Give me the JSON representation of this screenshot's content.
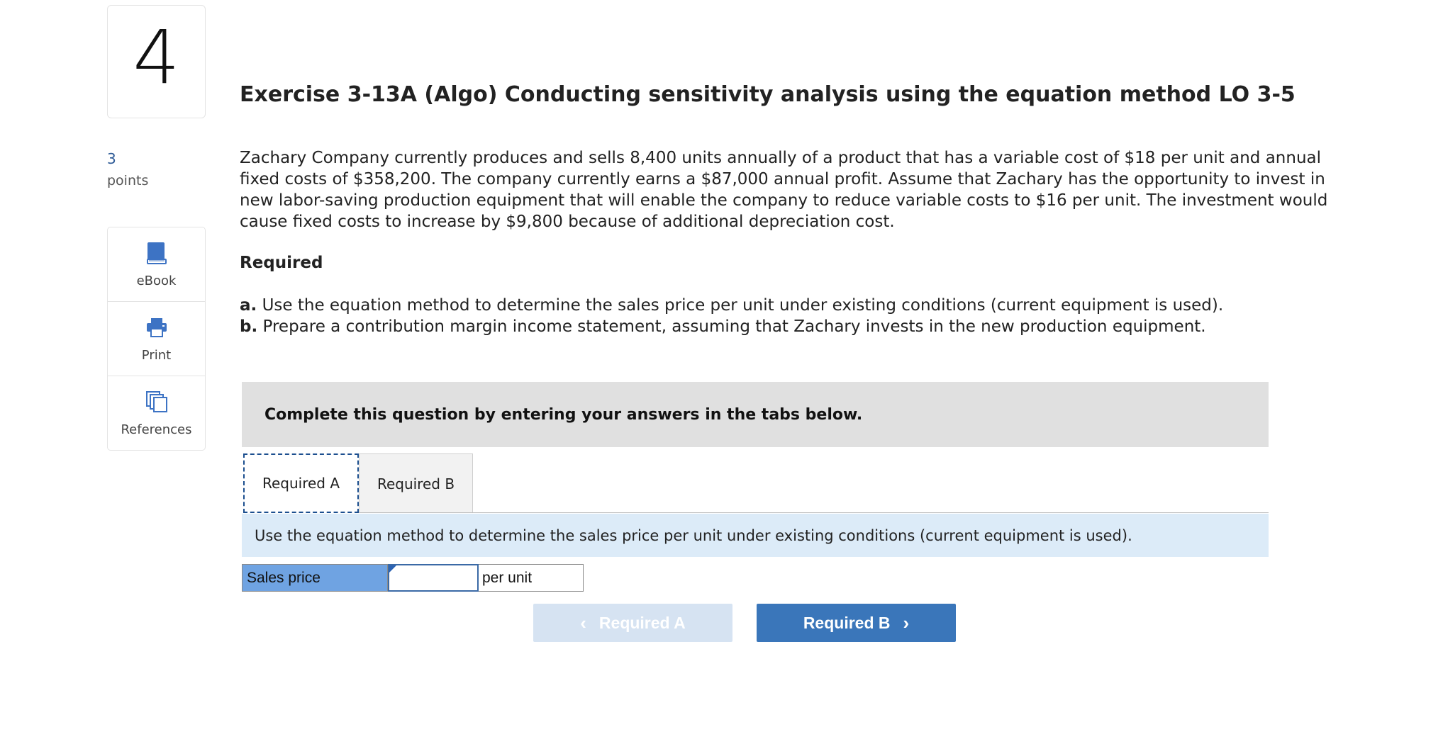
{
  "question": {
    "number": "4",
    "points_value": "3",
    "points_label": "points",
    "title": "Exercise 3-13A (Algo) Conducting sensitivity analysis using the equation method LO 3-5",
    "prompt": "Zachary Company currently produces and sells 8,400 units annually of a product that has a variable cost of $18 per unit and annual fixed costs of $358,200. The company currently earns a $87,000 annual profit. Assume that Zachary has the opportunity to invest in new labor-saving production equipment that will enable the company to reduce variable costs to $16 per unit. The investment would cause fixed costs to increase by $9,800 because of additional depreciation cost.",
    "required_heading": "Required",
    "requirements": [
      {
        "letter": "a.",
        "text": " Use the equation method to determine the sales price per unit under existing conditions (current equipment is used)."
      },
      {
        "letter": "b.",
        "text": " Prepare a contribution margin income statement, assuming that Zachary invests in the new production equipment."
      }
    ]
  },
  "sidebar": {
    "tools": [
      {
        "label": "eBook",
        "icon": "book-icon"
      },
      {
        "label": "Print",
        "icon": "printer-icon"
      },
      {
        "label": "References",
        "icon": "references-icon"
      }
    ]
  },
  "workspace": {
    "banner": "Complete this question by entering your answers in the tabs below.",
    "tabs": [
      {
        "label": "Required A",
        "active": true
      },
      {
        "label": "Required B",
        "active": false
      }
    ],
    "instruction": "Use the equation method to determine the sales price per unit under existing conditions (current equipment is used).",
    "answer": {
      "label": "Sales price",
      "value": "",
      "unit": "per unit"
    },
    "nav": {
      "prev_label": "Required A",
      "next_label": "Required B"
    }
  },
  "colors": {
    "accent": "#3a76ba",
    "accent_disabled": "#d6e3f2",
    "icon_blue": "#3d73c4",
    "label_cell": "#6fa3e2",
    "instruction_bg": "#dcebf8",
    "banner_bg": "#e0e0e0"
  }
}
